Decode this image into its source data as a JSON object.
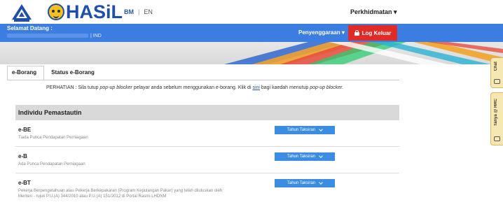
{
  "header": {
    "brand": "HASiL",
    "lang_bm": "BM",
    "lang_sep": "|",
    "lang_en": "EN",
    "services_menu": "Perkhidmatan"
  },
  "navbar": {
    "welcome": "Selamat Datang :",
    "user_suffix": "| IND",
    "maintenance_menu": "Penyenggaraan",
    "logout": "Log Keluar"
  },
  "tabs": [
    {
      "label": "e-Borang"
    },
    {
      "label": "Status e-Borang"
    }
  ],
  "notice": {
    "prefix": "PERHATIAN : Sila tutup ",
    "popup1": "pop-up blocker",
    "middle": " pelayar anda sebelum menggunakan e-borang. Klik di ",
    "link": "sini",
    "middle2": " bagi kaedah menutup ",
    "popup2": "pop-up blocker.",
    "end": ""
  },
  "section": {
    "title": "Individu Pemastautin",
    "forms": [
      {
        "code": "e-BE",
        "desc": "Tiada Punca Pendapatan Perniagaan",
        "button": "Tahun Taksiran"
      },
      {
        "code": "e-B",
        "desc": "Ada Punca Pendapatan Perniagaan",
        "button": "Tahun Taksiran"
      },
      {
        "code": "e-BT",
        "desc": "Pekerja Berpengetahuan atau Pekerja Berkepakaran (Program Kepulangan Pakar) yang telah diluluskan oleh Menteri - rujuk P.U.(A) 344/2010 atau P.U.(A) 151/2012 di Portal Rasmi LHDNM",
        "button": "Tahun Taksiran"
      }
    ]
  },
  "side": {
    "chat": "Chat",
    "tanya": "Tanya @ HRC"
  },
  "colors": {
    "nav_blue": "#3b7de0",
    "logout_red": "#e02b27",
    "button_blue": "#3b8de3"
  }
}
